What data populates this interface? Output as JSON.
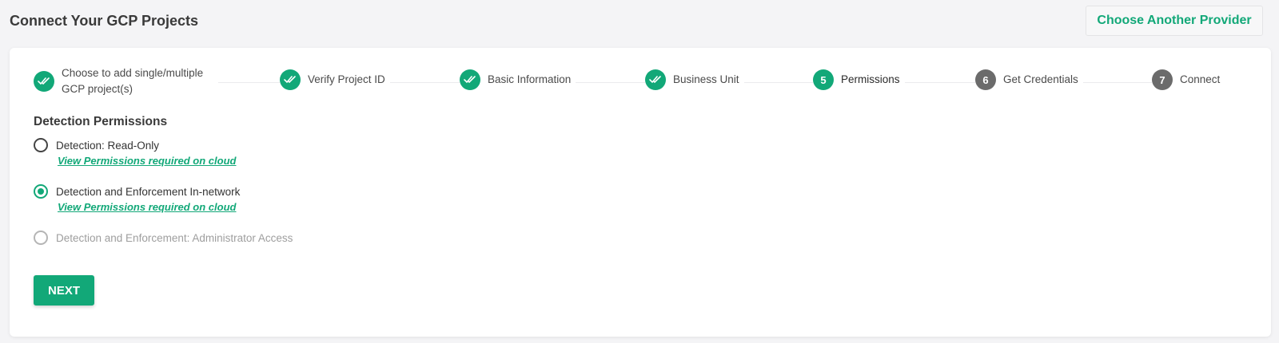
{
  "header": {
    "title": "Connect Your GCP Projects",
    "provider_button": "Choose Another Provider"
  },
  "stepper": {
    "steps": [
      {
        "label": "Choose to add single/multiple GCP project(s)",
        "status": "done",
        "number": "1"
      },
      {
        "label": "Verify Project ID",
        "status": "done",
        "number": "2"
      },
      {
        "label": "Basic Information",
        "status": "done",
        "number": "3"
      },
      {
        "label": "Business Unit",
        "status": "done",
        "number": "4"
      },
      {
        "label": "Permissions",
        "status": "active",
        "number": "5"
      },
      {
        "label": "Get Credentials",
        "status": "pending",
        "number": "6"
      },
      {
        "label": "Connect",
        "status": "pending",
        "number": "7"
      }
    ]
  },
  "permissions": {
    "title": "Detection Permissions",
    "options": [
      {
        "label": "Detection: Read-Only",
        "selected": false,
        "disabled": false,
        "link": "View Permissions required on cloud"
      },
      {
        "label": "Detection and Enforcement In-network",
        "selected": true,
        "disabled": false,
        "link": "View Permissions required on cloud"
      },
      {
        "label": "Detection and Enforcement: Administrator Access",
        "selected": false,
        "disabled": true
      }
    ]
  },
  "actions": {
    "next_label": "NEXT"
  },
  "colors": {
    "accent": "#12a878",
    "pending_step": "#6b6b6b",
    "background": "#f4f4f6"
  }
}
